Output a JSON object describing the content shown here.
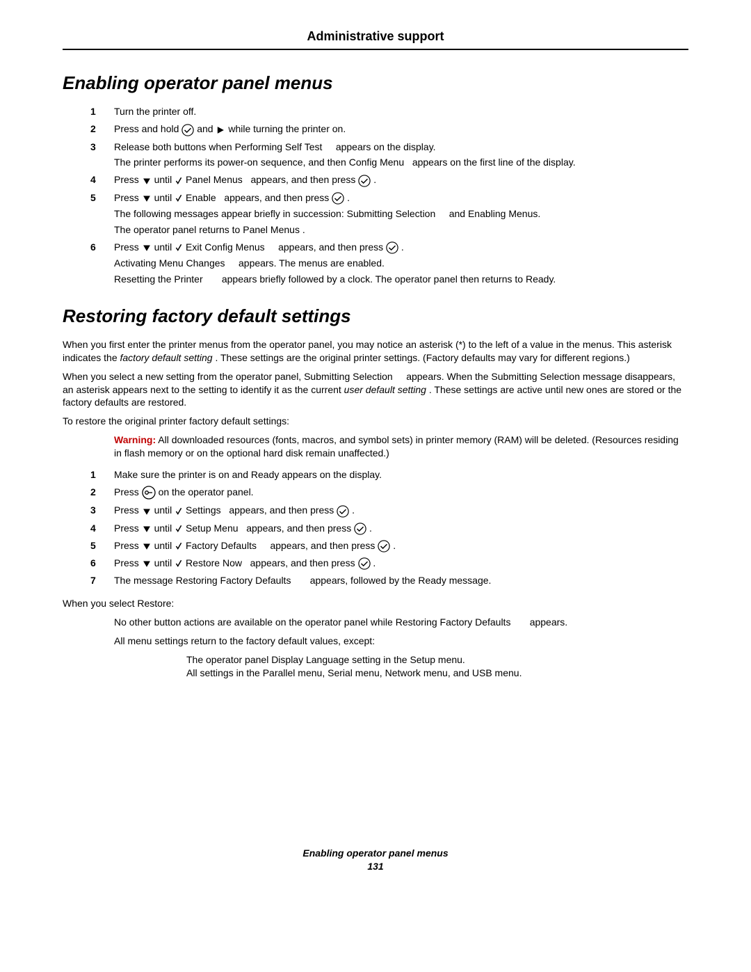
{
  "header": "Administrative support",
  "section1": {
    "title": "Enabling operator panel menus",
    "steps": [
      {
        "n": "1",
        "text": "Turn the printer off."
      },
      {
        "n": "2",
        "pre": "Press and hold ",
        "mid": " and ",
        "post": " while turning the printer on."
      },
      {
        "n": "3",
        "line1a": "Release both buttons when ",
        "line1b": "Performing Self Test",
        "line1c": " appears on the display.",
        "line2a": "The printer performs its power-on sequence, and then ",
        "line2b": "Config Menu",
        "line2c": " appears on the first line of the display."
      },
      {
        "n": "4",
        "a": "Press ",
        "b": " until ",
        "c": " Panel Menus",
        "d": " appears, and then press ",
        "e": "."
      },
      {
        "n": "5",
        "a": "Press ",
        "b": " until ",
        "c": " Enable",
        "d": " appears, and then press ",
        "e": ".",
        "s1a": "The following messages appear briefly in succession: ",
        "s1b": "Submitting Selection",
        "s1c": " and ",
        "s1d": "Enabling Menus.",
        "s2a": "The operator panel returns to ",
        "s2b": "Panel Menus",
        "s2c": "."
      },
      {
        "n": "6",
        "a": "Press ",
        "b": " until ",
        "c": " Exit Config Menus",
        "d": " appears, and then press ",
        "e": ".",
        "s1a": "Activating Menu Changes",
        "s1b": " appears. The menus are enabled.",
        "s2a": "Resetting the Printer",
        "s2b": " appears briefly followed by a clock. The operator panel then returns to ",
        "s2c": "Ready."
      }
    ]
  },
  "section2": {
    "title": "Restoring factory default settings",
    "p1a": "When you first enter the printer menus from the operator panel, you may notice an asterisk (*) to the left of a value in the menus. This asterisk indicates the ",
    "p1b": "factory default setting",
    "p1c": ". These settings are the original printer settings. (Factory defaults may vary for different regions.)",
    "p2a": "When you select a new setting from the operator panel, ",
    "p2b": "Submitting Selection",
    "p2c": " appears. When the Submitting Selection message disappears, an asterisk appears next to the setting to identify it as the current ",
    "p2d": "user default setting",
    "p2e": ". These settings are active until new ones are stored or the factory defaults are restored.",
    "p3": "To restore the original printer factory default settings:",
    "warnLabel": "Warning:",
    "warnText": " All downloaded resources (fonts, macros, and symbol sets) in printer memory (RAM) will be deleted. (Resources residing in flash memory or on the optional hard disk remain unaffected.)",
    "steps": [
      {
        "n": "1",
        "a": "Make sure the printer is on and ",
        "b": "Ready",
        "c": " appears on the display."
      },
      {
        "n": "2",
        "a": "Press ",
        "c": " on the operator panel."
      },
      {
        "n": "3",
        "a": "Press ",
        "b": " until ",
        "c": " Settings",
        "d": " appears, and then press ",
        "e": "."
      },
      {
        "n": "4",
        "a": "Press ",
        "b": " until ",
        "c": " Setup Menu",
        "d": " appears, and then press ",
        "e": "."
      },
      {
        "n": "5",
        "a": "Press ",
        "b": " until ",
        "c": " Factory Defaults",
        "d": " appears, and then press ",
        "e": "."
      },
      {
        "n": "6",
        "a": "Press ",
        "b": " until ",
        "c": " Restore Now",
        "d": " appears, and then press ",
        "e": "."
      },
      {
        "n": "7",
        "a": "The message ",
        "b": "Restoring Factory Defaults",
        "c": " appears, followed by the ",
        "d": "Ready",
        "e": " message."
      }
    ],
    "p4": "When you select Restore:",
    "r1a": "No other button actions are available on the operator panel while ",
    "r1b": "Restoring Factory Defaults",
    "r1c": " appears.",
    "r2": "All menu settings return to the factory default values, except:",
    "r3a": "The operator panel Display Language setting in the Setup menu.",
    "r3b": "All settings in the Parallel menu, Serial menu, Network menu, and USB menu."
  },
  "footer": {
    "title": "Enabling operator panel menus",
    "page": "131"
  }
}
